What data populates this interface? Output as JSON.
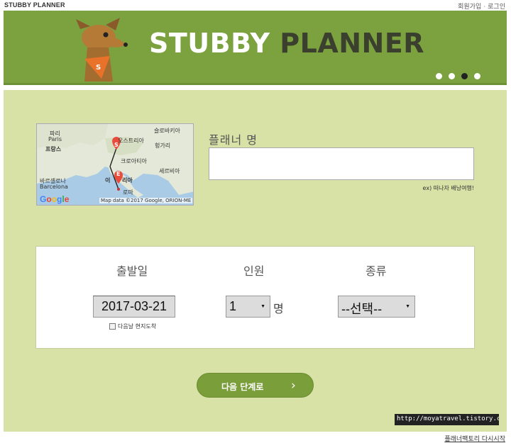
{
  "header": {
    "title": "STUBBY PLANNER",
    "links": [
      "회원가입",
      "로그인"
    ],
    "link_separator": "·"
  },
  "banner": {
    "logo_word1": "STUBBY",
    "logo_word2": "PLANNER",
    "dog_tag_letter": "S",
    "slides": 4,
    "active_slide": 3,
    "bg_color": "#7ba23f"
  },
  "map": {
    "labels": [
      "파리",
      "Paris",
      "프랑스",
      "오스트리아",
      "슬로바키아",
      "헝가리",
      "크로아티아",
      "세르비아",
      "바르셀로나",
      "Barcelona",
      "이",
      "리아",
      "로마"
    ],
    "start_marker": "S",
    "end_marker": "E",
    "google": [
      "G",
      "o",
      "o",
      "g",
      "l",
      "e"
    ],
    "credit": "Map data ©2017 Google, ORION-ME"
  },
  "planner_name": {
    "label": "플래너 명",
    "value": "",
    "hint": "ex) 떠나자 배낭여행!"
  },
  "form": {
    "departure_label": "출발일",
    "departure_value": "2017-03-21",
    "next_day_label": "다음날 현지도착",
    "people_label": "인원",
    "people_value": "1",
    "people_unit": "명",
    "type_label": "종류",
    "type_value": "--선택--"
  },
  "actions": {
    "next_label": "다음 단계로",
    "next_icon": "›"
  },
  "watermark": "http://moyatravel.tistory.com",
  "footer": {
    "restart_label": "플래너팩토리 다시시작"
  }
}
